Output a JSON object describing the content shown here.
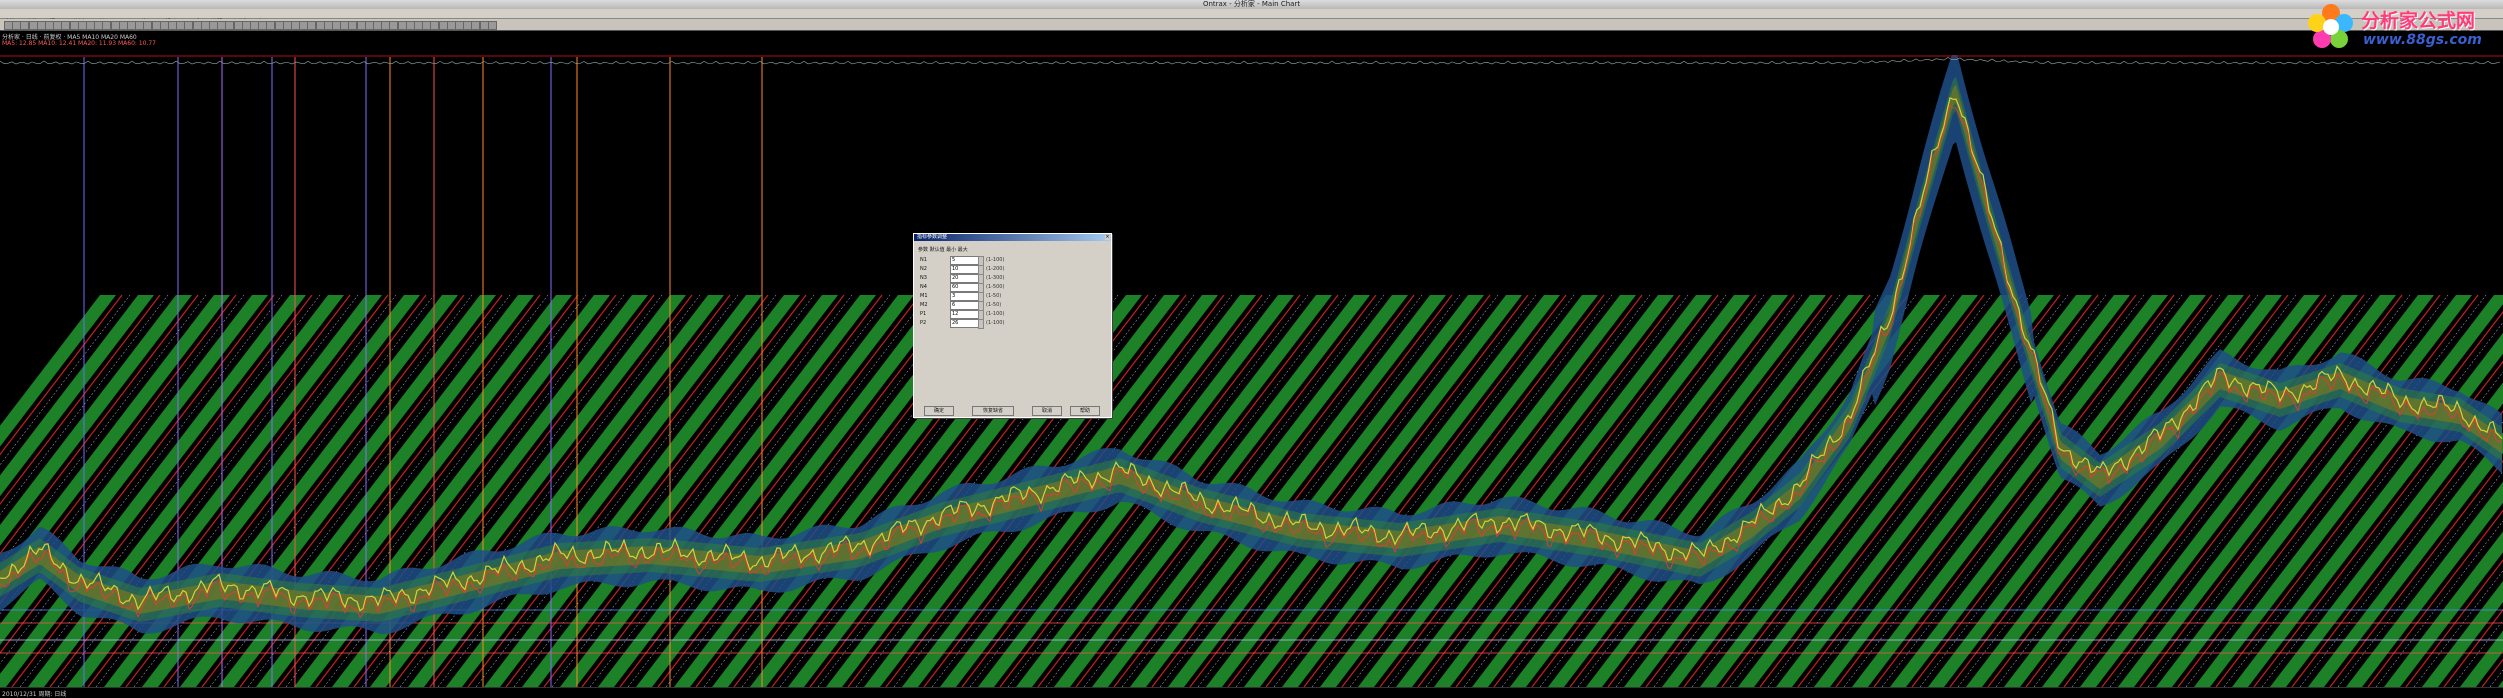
{
  "window": {
    "title": "Ontrax - 分析家 - Main Chart"
  },
  "menu": [
    "系统",
    "功能",
    "报价",
    "分析",
    "财经",
    "工具",
    "资讯",
    "帮助",
    "公式",
    "选股",
    "测试",
    "窗口"
  ],
  "info": {
    "line1": "分析家 · 日线 · 前复权 · MA5 MA10 MA20 MA60",
    "line2": "MA5: 12.85  MA10: 12.41  MA20: 11.93  MA60: 10.77"
  },
  "logo": {
    "name": "分析家公式网",
    "url": "www.88gs.com"
  },
  "status": {
    "text": "2010/12/31  周期: 日线"
  },
  "dialog": {
    "title": "指标参数调整",
    "subtitle": "参数  默认值  最小  最大",
    "params": [
      {
        "label": "N1",
        "value": "5",
        "note": "(1-100)"
      },
      {
        "label": "N2",
        "value": "10",
        "note": "(1-200)"
      },
      {
        "label": "N3",
        "value": "20",
        "note": "(1-300)"
      },
      {
        "label": "N4",
        "value": "60",
        "note": "(1-500)"
      },
      {
        "label": "M1",
        "value": "3",
        "note": "(1-50)"
      },
      {
        "label": "M2",
        "value": "6",
        "note": "(1-50)"
      },
      {
        "label": "P1",
        "value": "12",
        "note": "(1-100)"
      },
      {
        "label": "P2",
        "value": "26",
        "note": "(1-100)"
      }
    ],
    "buttons": {
      "ok": "确定",
      "default": "恢复缺省",
      "cancel": "取消",
      "help": "帮助"
    },
    "close": "×"
  },
  "colors": {
    "stripe_green": "#1f8f2b",
    "stripe_red": "#c42121",
    "band_blue": "#1e4f88",
    "band_orange": "#b56a13",
    "price_yellow": "#d6d236"
  }
}
